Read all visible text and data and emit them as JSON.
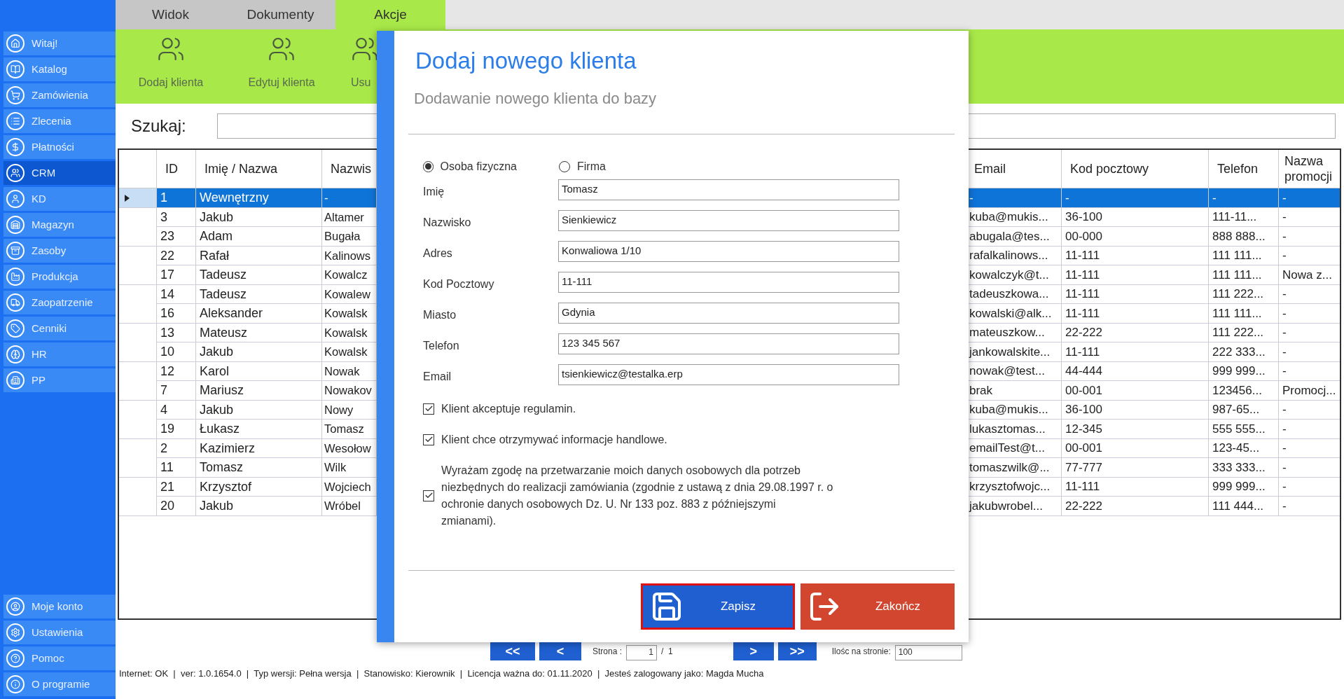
{
  "sidebar": {
    "items": [
      {
        "label": "Witaj!",
        "selected": false
      },
      {
        "label": "Katalog",
        "selected": false
      },
      {
        "label": "Zamówienia",
        "selected": false
      },
      {
        "label": "Zlecenia",
        "selected": false
      },
      {
        "label": "Płatności",
        "selected": false
      },
      {
        "label": "CRM",
        "selected": true
      },
      {
        "label": "KD",
        "selected": false
      },
      {
        "label": "Magazyn",
        "selected": false
      },
      {
        "label": "Zasoby",
        "selected": false
      },
      {
        "label": "Produkcja",
        "selected": false
      },
      {
        "label": "Zaopatrzenie",
        "selected": false
      },
      {
        "label": "Cenniki",
        "selected": false
      },
      {
        "label": "HR",
        "selected": false
      },
      {
        "label": "PP",
        "selected": false
      }
    ],
    "bottom_items": [
      {
        "label": "Moje konto"
      },
      {
        "label": "Ustawienia"
      },
      {
        "label": "Pomoc"
      },
      {
        "label": "O programie"
      }
    ]
  },
  "tabs": [
    {
      "label": "Widok",
      "selected": false
    },
    {
      "label": "Dokumenty",
      "selected": false
    },
    {
      "label": "Akcje",
      "selected": true
    }
  ],
  "ribbon": [
    {
      "label": "Dodaj klienta"
    },
    {
      "label": "Edytuj klienta"
    },
    {
      "label": "Usu"
    }
  ],
  "search": {
    "label": "Szukaj:"
  },
  "table": {
    "columns": [
      "ID",
      "Imię / Nazwa",
      "Nazwis",
      "Email",
      "Kod pocztowy",
      "Telefon",
      "Nazwa promocji"
    ],
    "rows": [
      {
        "selected": true,
        "cells": [
          "1",
          "Wewnętrzny",
          "-",
          "-",
          "-",
          "-",
          "-"
        ]
      },
      {
        "selected": false,
        "cells": [
          "3",
          "Jakub",
          "Altamer",
          "kuba@mukis...",
          "36-100",
          "111-11...",
          "-"
        ]
      },
      {
        "selected": false,
        "cells": [
          "23",
          "Adam",
          "Bugała",
          "abugala@tes...",
          "00-000",
          "888 888...",
          "-"
        ]
      },
      {
        "selected": false,
        "cells": [
          "22",
          "Rafał",
          "Kalinows",
          "rafalkalinows...",
          "11-111",
          "111 111...",
          "-"
        ]
      },
      {
        "selected": false,
        "cells": [
          "17",
          "Tadeusz",
          "Kowalcz",
          "kowalczyk@t...",
          "11-111",
          "111 111...",
          "Nowa z..."
        ]
      },
      {
        "selected": false,
        "cells": [
          "14",
          "Tadeusz",
          "Kowalew",
          "tadeuszkowa...",
          "11-111",
          "111 222...",
          "-"
        ]
      },
      {
        "selected": false,
        "cells": [
          "16",
          "Aleksander",
          "Kowalsk",
          "kowalski@alk...",
          "11-111",
          "111 111...",
          "-"
        ]
      },
      {
        "selected": false,
        "cells": [
          "13",
          "Mateusz",
          "Kowalsk",
          "mateuszkow...",
          "22-222",
          "111 222...",
          "-"
        ]
      },
      {
        "selected": false,
        "cells": [
          "10",
          "Jakub",
          "Kowalsk",
          "jankowalskite...",
          "11-111",
          "222 333...",
          "-"
        ]
      },
      {
        "selected": false,
        "cells": [
          "12",
          "Karol",
          "Nowak",
          "nowak@test...",
          "44-444",
          "999 999...",
          "-"
        ]
      },
      {
        "selected": false,
        "cells": [
          "7",
          "Mariusz",
          "Nowakov",
          "brak",
          "00-001",
          "123456...",
          "Promocj..."
        ]
      },
      {
        "selected": false,
        "cells": [
          "4",
          "Jakub",
          "Nowy",
          "kuba@mukis...",
          "36-100",
          "987-65...",
          "-"
        ]
      },
      {
        "selected": false,
        "cells": [
          "19",
          "Łukasz",
          "Tomasz",
          "lukasztomas...",
          "12-345",
          "555 555...",
          "-"
        ]
      },
      {
        "selected": false,
        "cells": [
          "2",
          "Kazimierz",
          "Wesołow",
          "emailTest@t...",
          "00-001",
          "123-45...",
          "-"
        ]
      },
      {
        "selected": false,
        "cells": [
          "11",
          "Tomasz",
          "Wilk",
          "tomaszwilk@...",
          "77-777",
          "333 333...",
          "-"
        ]
      },
      {
        "selected": false,
        "cells": [
          "21",
          "Krzysztof",
          "Wojciech",
          "krzysztofwojc...",
          "11-111",
          "999 999...",
          "-"
        ]
      },
      {
        "selected": false,
        "cells": [
          "20",
          "Jakub",
          "Wróbel",
          "jakubwrobel...",
          "22-222",
          "111 444...",
          "-"
        ]
      }
    ]
  },
  "pagination": {
    "first": "<<",
    "prev": "<",
    "page_label": "Strona :",
    "page": "1",
    "of": "/  1",
    "next": ">",
    "last": ">>",
    "per_page_label": "Ilośc na stronie:",
    "per_page": "100"
  },
  "status_bar": "Internet: OK  |  ver: 1.0.1654.0  |  Typ wersji: Pełna wersja  |  Stanowisko: Kierownik  |  Licencja ważna do: 01.11.2020  |  Jesteś zalogowany jako: Magda Mucha",
  "dialog": {
    "title": "Dodaj nowego klienta",
    "subtitle": "Dodawanie nowego klienta do bazy",
    "type_options": [
      {
        "label": "Osoba fizyczna",
        "selected": true
      },
      {
        "label": "Firma",
        "selected": false
      }
    ],
    "fields": [
      {
        "label": "Imię",
        "value": "Tomasz"
      },
      {
        "label": "Nazwisko",
        "value": "Sienkiewicz"
      },
      {
        "label": "Adres",
        "value": "Konwaliowa 1/10"
      },
      {
        "label": "Kod Pocztowy",
        "value": "11-111"
      },
      {
        "label": "Miasto",
        "value": "Gdynia"
      },
      {
        "label": "Telefon",
        "value": "123 345 567"
      },
      {
        "label": "Email",
        "value": "tsienkiewicz@testalka.erp"
      }
    ],
    "consents": [
      {
        "text": "Klient akceptuje regulamin.",
        "checked": true
      },
      {
        "text": "Klient chce otrzymywać informacje handlowe.",
        "checked": true
      },
      {
        "text": "Wyrażam zgodę na przetwarzanie moich danych osobowych dla potrzeb niezbędnych do realizacji zamówiania (zgodnie z ustawą z dnia 29.08.1997 r. o ochronie danych osobowych Dz. U. Nr 133 poz. 883 z późniejszymi zmianami).",
        "checked": true
      }
    ],
    "buttons": [
      {
        "label": "Zapisz",
        "kind": "save"
      },
      {
        "label": "Zakończ",
        "kind": "exit"
      }
    ]
  }
}
